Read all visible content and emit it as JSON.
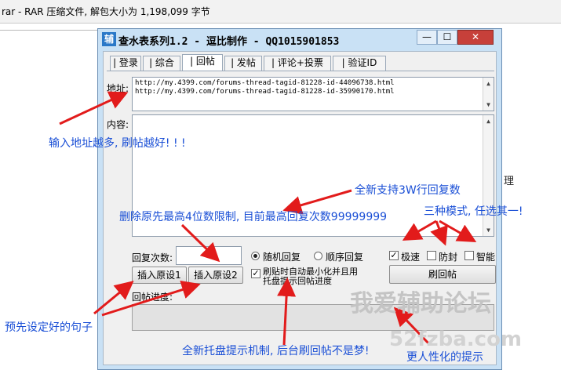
{
  "background_window": {
    "title": "rar - RAR 压缩文件, 解包大小为 1,198,099 字节",
    "right_fragment": "理"
  },
  "app": {
    "icon_text": "辅",
    "title": "查水表系列1.2 - 逗比制作 - QQ1015901853",
    "window_buttons": {
      "minimize": "—",
      "maximize": "☐",
      "close": "✕"
    },
    "tabs": [
      "登录",
      "综合",
      "回帖",
      "发帖",
      "评论+投票",
      "验证ID"
    ],
    "active_tab": "回帖",
    "address_label": "地址:",
    "address_lines": [
      "http://my.4399.com/forums-thread-tagid-81228-id-44096738.html",
      "http://my.4399.com/forums-thread-tagid-81228-id-35990170.html"
    ],
    "content_label": "内容:",
    "reply_count_label": "回复次数:",
    "reply_count_value": "",
    "insert_preset_1": "插入原设1",
    "insert_preset_2": "插入原设2",
    "mode_random": "随机回复",
    "mode_sequential": "顺序回复",
    "tray_option": "刷贴时自动最小化并且用托盘提示回帖进度",
    "check_speed": "极速",
    "check_anti_block": "防封",
    "check_smart": "智能",
    "refresh_button": "刷回帖",
    "progress_label": "回帖进度:"
  },
  "annotations": {
    "address_tip": "输入地址越多, 刷帖越好! ! !",
    "new_support": "全新支持3W行回复数",
    "limit_removed": "删除原先最高4位数限制, 目前最高回复次数99999999",
    "three_modes": "三种模式, 任选其一!",
    "preset_sentence": "预先设定好的句子",
    "tray_tip": "全新托盘提示机制, 后台刷回帖不是梦!",
    "friendly_tip": "更人性化的提示"
  },
  "watermark": {
    "line1": "我爱辅助论坛",
    "line2": "52fzba.com"
  },
  "colors": {
    "annotation": "#1a4fd6",
    "arrow": "#e21b1b",
    "window_frame": "#c9e1f5",
    "close_button": "#c7403a"
  }
}
